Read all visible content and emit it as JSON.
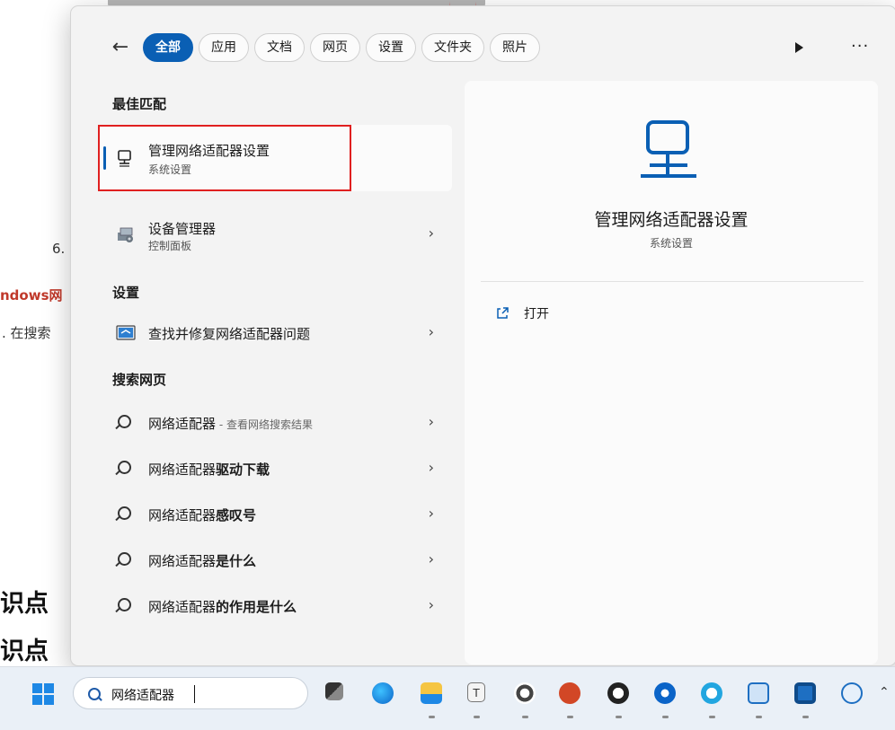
{
  "background_page": {
    "list_number": "6.",
    "red_link_text": "ndows网",
    "step_text": ". 在搜索",
    "heading_1": "识点",
    "heading_2": "识点"
  },
  "filters": {
    "back_icon": "back-arrow-icon",
    "tabs": [
      {
        "label": "全部",
        "active": true
      },
      {
        "label": "应用",
        "active": false
      },
      {
        "label": "文档",
        "active": false
      },
      {
        "label": "网页",
        "active": false
      },
      {
        "label": "设置",
        "active": false
      },
      {
        "label": "文件夹",
        "active": false
      },
      {
        "label": "照片",
        "active": false
      }
    ],
    "play_icon": "play-icon",
    "more_icon": "more-icon"
  },
  "sections": {
    "best_match": "最佳匹配",
    "settings": "设置",
    "search_web": "搜索网页"
  },
  "best_match": {
    "title": "管理网络适配器设置",
    "subtitle": "系统设置"
  },
  "results": {
    "device_manager": {
      "title": "设备管理器",
      "subtitle": "控制面板"
    },
    "troubleshoot": {
      "title": "查找并修复网络适配器问题"
    },
    "web": [
      {
        "prefix": "网络适配器",
        "bold": "",
        "suffix": " - 查看网络搜索结果"
      },
      {
        "prefix": "网络适配器",
        "bold": "驱动下载",
        "suffix": ""
      },
      {
        "prefix": "网络适配器",
        "bold": "感叹号",
        "suffix": ""
      },
      {
        "prefix": "网络适配器",
        "bold": "是什么",
        "suffix": ""
      },
      {
        "prefix": "网络适配器",
        "bold": "的作用是什么",
        "suffix": ""
      }
    ]
  },
  "detail": {
    "title": "管理网络适配器设置",
    "subtitle": "系统设置",
    "open_label": "打开"
  },
  "taskbar": {
    "search_text": "网络适配器",
    "pinned_icons": [
      "task-view-icon",
      "edge-icon",
      "file-explorer-icon",
      "notepad-icon",
      "chrome-icon",
      "powerpoint-icon",
      "obs-icon",
      "browser-icon",
      "chat-icon",
      "remote-desktop-icon",
      "app-icon",
      "network-globe-icon"
    ]
  },
  "colors": {
    "accent": "#0a5fb4",
    "highlight_box": "#e02020"
  }
}
